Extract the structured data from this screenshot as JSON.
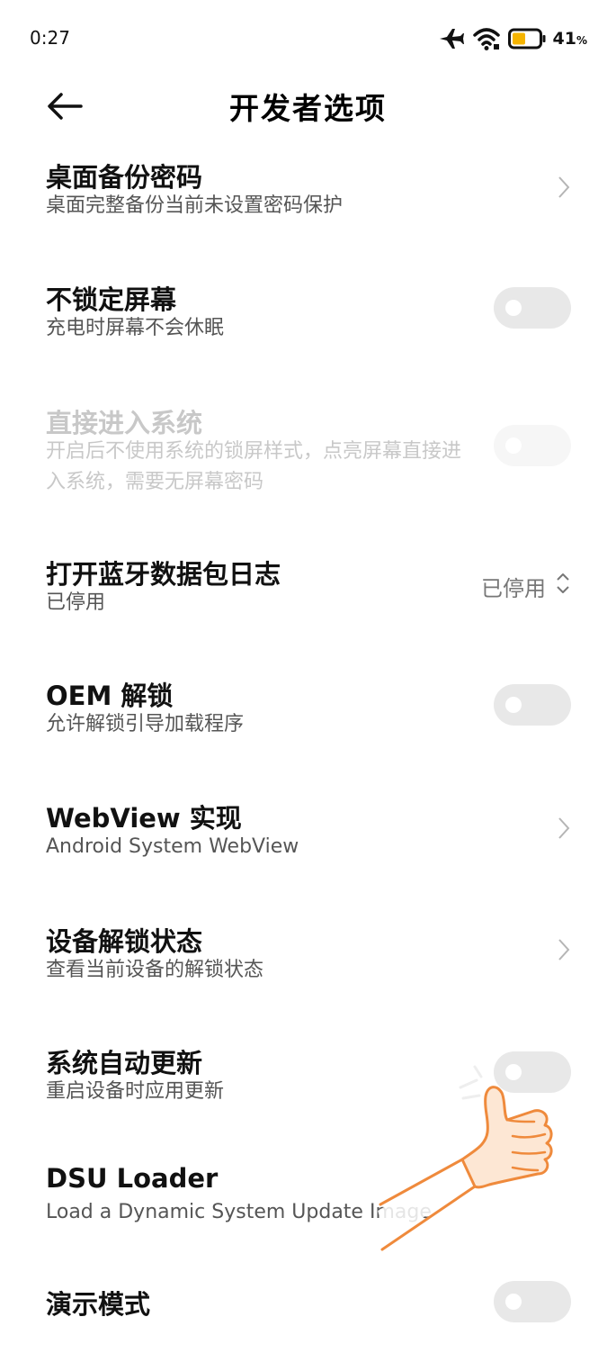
{
  "status_bar": {
    "time": "0:27",
    "battery_percent": "41",
    "battery_unit": "%"
  },
  "header": {
    "title": "开发者选项"
  },
  "settings": [
    {
      "title": "桌面备份密码",
      "subtitle": "桌面完整备份当前未设置密码保护",
      "control": "chevron"
    },
    {
      "title": "不锁定屏幕",
      "subtitle": "充电时屏幕不会休眠",
      "control": "toggle",
      "on": false
    },
    {
      "title": "直接进入系统",
      "subtitle": "开启后不使用系统的锁屏样式，点亮屏幕直接进入系统，需要无屏幕密码",
      "control": "toggle",
      "on": false,
      "disabled": true
    },
    {
      "title": "打开蓝牙数据包日志",
      "subtitle": "已停用",
      "control": "dropdown",
      "value": "已停用"
    },
    {
      "title": "OEM 解锁",
      "subtitle": "允许解锁引导加载程序",
      "control": "toggle",
      "on": false
    },
    {
      "title": "WebView 实现",
      "subtitle": "Android System WebView",
      "control": "chevron"
    },
    {
      "title": "设备解锁状态",
      "subtitle": "查看当前设备的解锁状态",
      "control": "chevron"
    },
    {
      "title": "系统自动更新",
      "subtitle": "重启设备时应用更新",
      "control": "toggle",
      "on": false
    },
    {
      "title": "DSU Loader",
      "subtitle": "Load a Dynamic System Update Image",
      "control": "none"
    },
    {
      "title": "演示模式",
      "control": "toggle",
      "on": false
    }
  ],
  "colors": {
    "toggle_off": "#e8e8e8",
    "battery_fill": "#f5b400",
    "thumb_outline": "#ef8a3c",
    "thumb_fill": "#fde7d4"
  },
  "icons": [
    "back-arrow-icon",
    "airplane-icon",
    "wifi-icon",
    "battery-icon",
    "chevron-right-icon",
    "up-down-icon",
    "thumbs-up-icon"
  ]
}
